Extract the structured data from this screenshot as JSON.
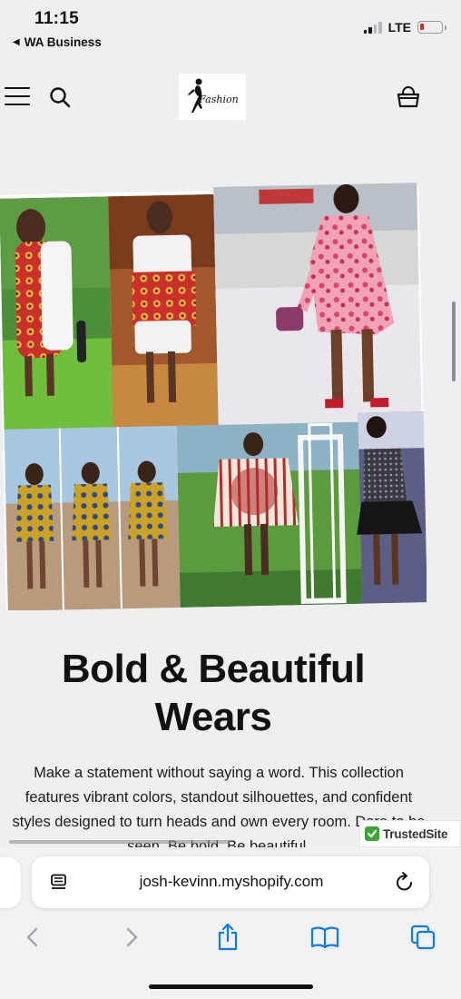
{
  "status_bar": {
    "time": "11:15",
    "back_app": "WA Business",
    "network": "LTE",
    "battery_level": 0.15
  },
  "header": {
    "logo_text": "Fashion",
    "icons": [
      "menu-icon",
      "search-icon",
      "cart-icon"
    ]
  },
  "hero": {
    "headline_line1": "Bold & Beautiful",
    "headline_line2": "Wears",
    "body": "Make a statement without saying a word. This collection features vibrant colors, standout silhouettes, and confident styles designed to turn heads and own every room. Dare to be seen. Be bold. Be beautiful."
  },
  "trusted_badge": {
    "text": "TrustedSite"
  },
  "browser": {
    "url": "josh-kevinn.myshopify.com",
    "toolbar": [
      "back-icon",
      "forward-icon",
      "share-icon",
      "bookmarks-icon",
      "tabs-icon"
    ]
  },
  "colors": {
    "background": "#efeff1",
    "accent_blue": "#0a7aff",
    "battery_red": "#e5231f",
    "trusted_green": "#3aa437"
  }
}
